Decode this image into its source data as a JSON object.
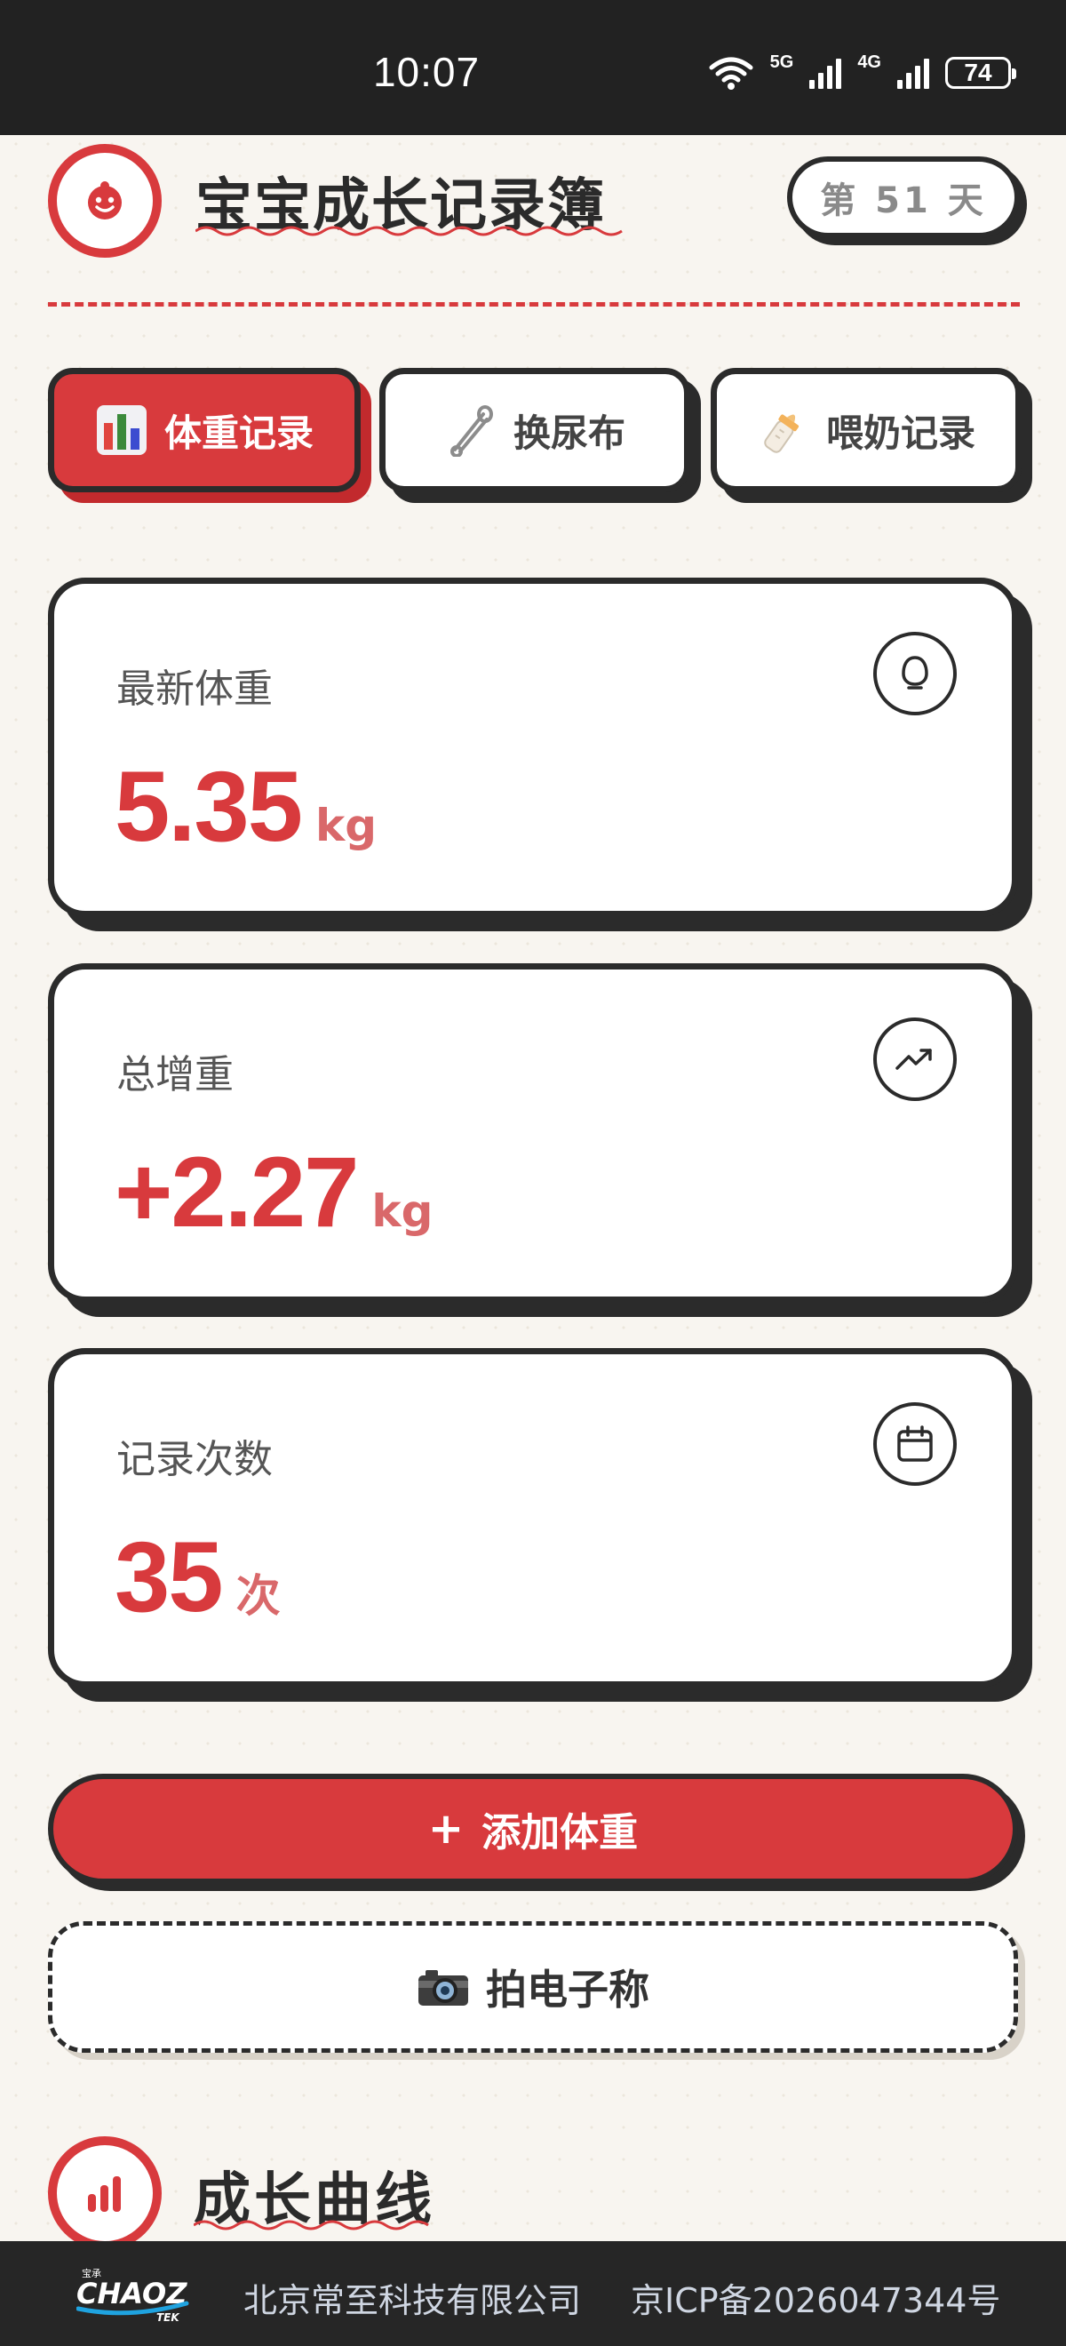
{
  "status_bar": {
    "time": "10:07",
    "network_1": "5G",
    "network_2": "4G",
    "battery": "74"
  },
  "header": {
    "title": "宝宝成长记录簿",
    "day_badge": "第 51 天"
  },
  "tabs": [
    {
      "label": "体重记录",
      "icon": "bar-chart-emoji-icon",
      "active": true
    },
    {
      "label": "换尿布",
      "icon": "safety-pin-icon",
      "active": false
    },
    {
      "label": "喂奶记录",
      "icon": "baby-bottle-icon",
      "active": false
    }
  ],
  "cards": [
    {
      "label": "最新体重",
      "value": "5.35",
      "unit": "kg",
      "icon": "weight-egg-icon"
    },
    {
      "label": "总增重",
      "value": "+2.27",
      "unit": "kg",
      "icon": "trend-up-icon"
    },
    {
      "label": "记录次数",
      "value": "35",
      "unit": "次",
      "icon": "calendar-icon"
    }
  ],
  "actions": {
    "add_plus": "+",
    "add_label": "添加体重",
    "scale_label": "拍电子称"
  },
  "section": {
    "title": "成长曲线"
  },
  "footer": {
    "logo_top": "宝承",
    "logo_main": "CHAOZ",
    "logo_sub": "TEK",
    "company": "北京常至科技有限公司",
    "icp": "京ICP备2026047344号"
  },
  "colors": {
    "accent": "#d83a3d",
    "ink": "#2b2b2b",
    "background": "#f8f5f0"
  }
}
